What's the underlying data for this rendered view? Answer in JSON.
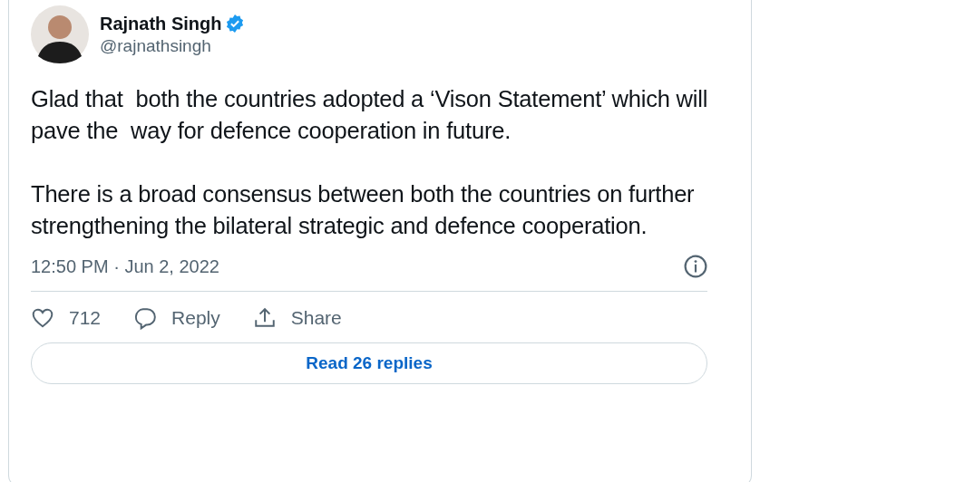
{
  "author": {
    "name": "Rajnath Singh",
    "handle": "@rajnathsingh",
    "verified": true
  },
  "paragraphs": [
    "Glad that  both the countries adopted a ‘Vison Statement’ which will pave the  way for defence cooperation in future.",
    "There is a broad consensus between both the countries on further strengthening the bilateral strategic and defence cooperation."
  ],
  "timestamp": "12:50 PM · Jun 2, 2022",
  "actions": [
    {
      "kind": "like",
      "label": "712"
    },
    {
      "kind": "reply",
      "label": "Reply"
    },
    {
      "kind": "share",
      "label": "Share"
    }
  ],
  "read_button": "Read 26 replies"
}
